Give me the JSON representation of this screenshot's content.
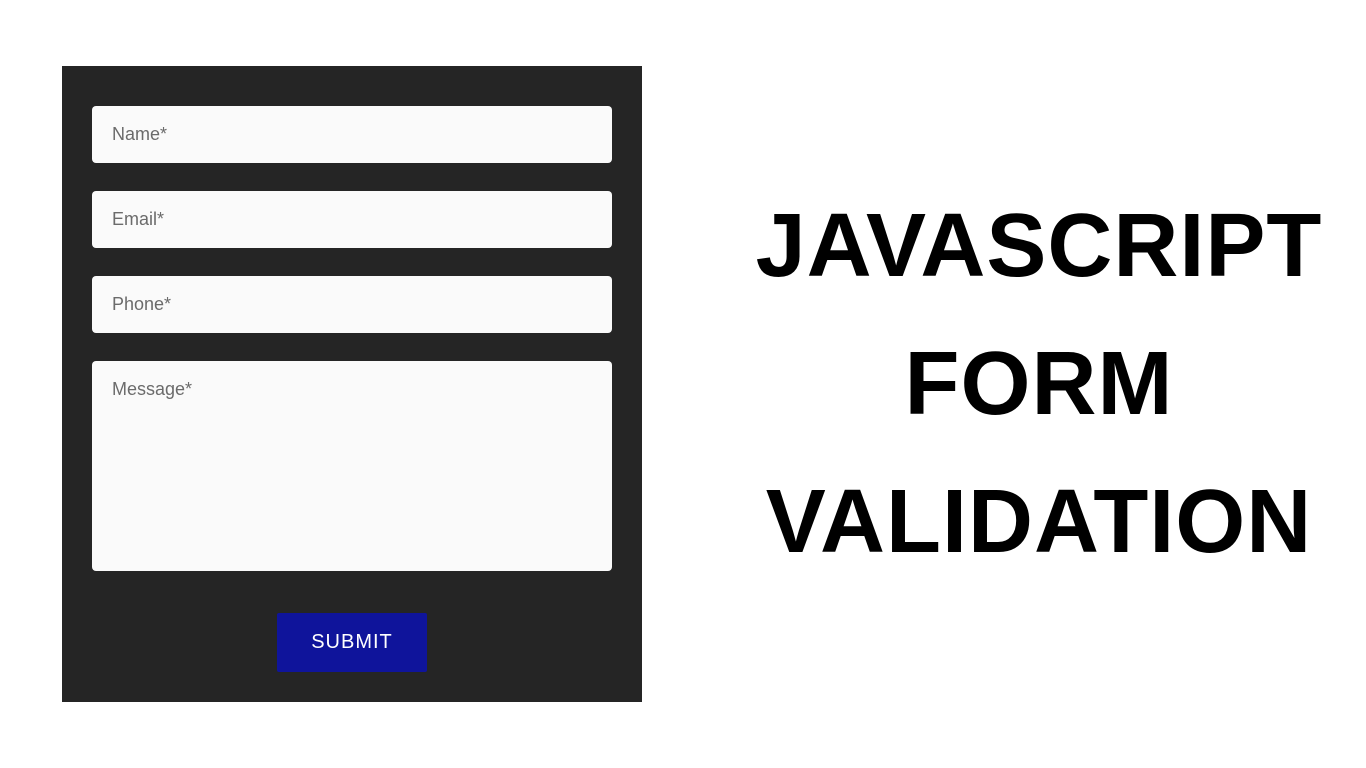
{
  "form": {
    "fields": {
      "name": {
        "placeholder": "Name*",
        "value": ""
      },
      "email": {
        "placeholder": "Email*",
        "value": ""
      },
      "phone": {
        "placeholder": "Phone*",
        "value": ""
      },
      "message": {
        "placeholder": "Message*",
        "value": ""
      }
    },
    "submit_label": "SUBMIT"
  },
  "title": {
    "line1": "JAVASCRIPT",
    "line2": "FORM",
    "line3": "VALIDATION"
  },
  "colors": {
    "panel_bg": "#252525",
    "input_bg": "#fafafa",
    "button_bg": "#0f149b",
    "button_text": "#ffffff",
    "title_text": "#000000"
  }
}
